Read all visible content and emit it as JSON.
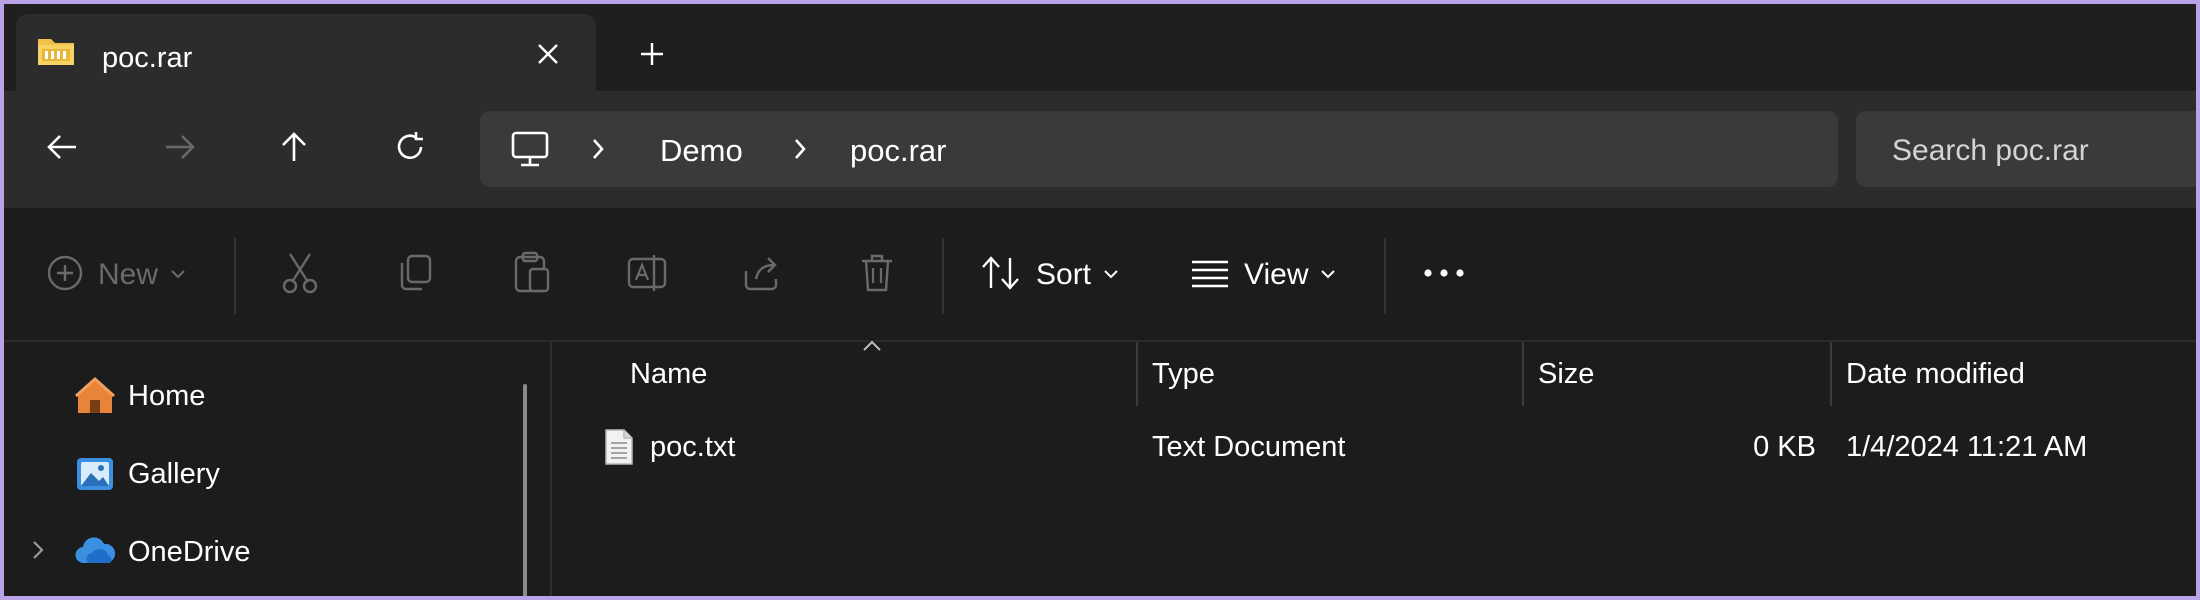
{
  "tab": {
    "title": "poc.rar",
    "close_icon": "close-icon",
    "new_tab_icon": "plus-icon"
  },
  "nav": {
    "back_icon": "arrow-left-icon",
    "forward_icon": "arrow-right-icon",
    "up_icon": "arrow-up-icon",
    "refresh_icon": "refresh-icon"
  },
  "address": {
    "root_icon": "this-pc-icon",
    "crumbs": [
      "Demo",
      "poc.rar"
    ]
  },
  "search": {
    "placeholder": "Search poc.rar"
  },
  "toolbar": {
    "new_label": "New",
    "sort_label": "Sort",
    "view_label": "View"
  },
  "sidebar": {
    "items": [
      {
        "label": "Home",
        "icon": "home-icon"
      },
      {
        "label": "Gallery",
        "icon": "gallery-icon"
      },
      {
        "label": "OneDrive",
        "icon": "onedrive-icon"
      }
    ]
  },
  "columns": [
    "Name",
    "Type",
    "Size",
    "Date modified"
  ],
  "files": [
    {
      "name": "poc.txt",
      "type": "Text Document",
      "size": "0 KB",
      "date": "1/4/2024 11:21 AM",
      "icon": "text-file-icon"
    }
  ],
  "colors": {
    "background": "#1c1c1c",
    "panel": "#2c2c2c",
    "folder_yellow": "#f1c24a",
    "onedrive_blue": "#3a8fe0",
    "disabled": "#6a6a6a"
  }
}
